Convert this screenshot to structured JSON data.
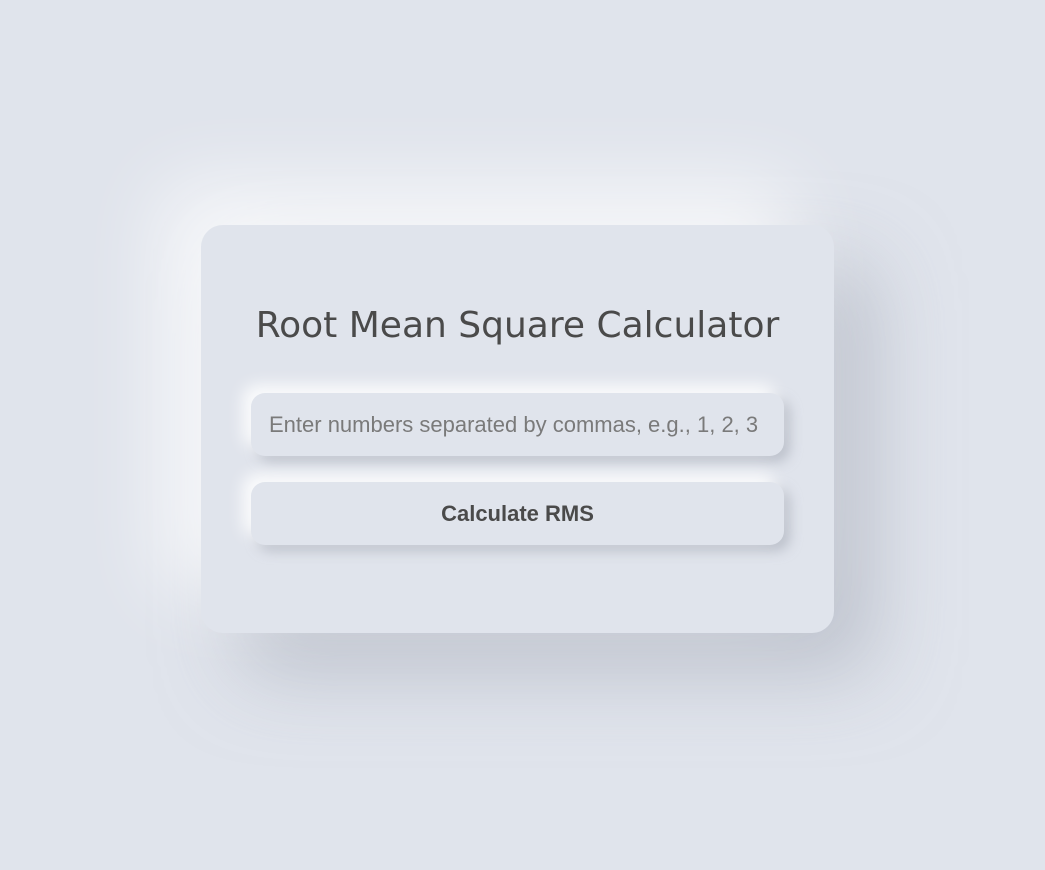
{
  "calculator": {
    "title": "Root Mean Square Calculator",
    "input": {
      "value": "",
      "placeholder": "Enter numbers separated by commas, e.g., 1, 2, 3"
    },
    "calculate_label": "Calculate RMS"
  },
  "colors": {
    "background": "#e0e4ec",
    "text": "#4a4a4a",
    "placeholder": "#7a7a7a"
  }
}
